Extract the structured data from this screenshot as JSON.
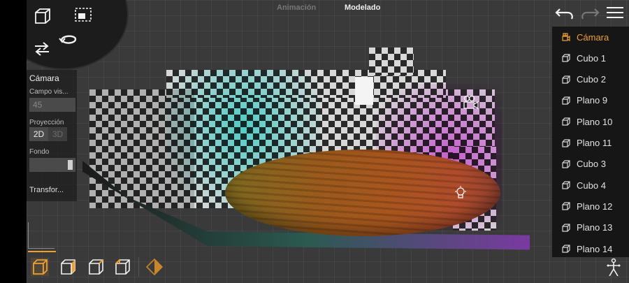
{
  "tabs": [
    {
      "label": "Animación",
      "active": false
    },
    {
      "label": "Modelado",
      "active": true
    }
  ],
  "properties": {
    "title": "Cámara",
    "fov_label": "Campo vis...",
    "fov_value": "45",
    "projection_label": "Proyección",
    "projection_2d": "2D",
    "projection_3d": "3D",
    "background_label": "Fondo",
    "transform_label": "Transfor..."
  },
  "outliner": {
    "items": [
      {
        "label": "Cámara",
        "type": "camera",
        "selected": true
      },
      {
        "label": "Cubo 1",
        "type": "mesh",
        "selected": false
      },
      {
        "label": "Cubo 2",
        "type": "mesh",
        "selected": false
      },
      {
        "label": "Plano 9",
        "type": "mesh",
        "selected": false
      },
      {
        "label": "Plano 10",
        "type": "mesh",
        "selected": false
      },
      {
        "label": "Plano 11",
        "type": "mesh",
        "selected": false
      },
      {
        "label": "Cubo 3",
        "type": "mesh",
        "selected": false
      },
      {
        "label": "Cubo 4",
        "type": "mesh",
        "selected": false
      },
      {
        "label": "Plano 12",
        "type": "mesh",
        "selected": false
      },
      {
        "label": "Plano 13",
        "type": "mesh",
        "selected": false
      },
      {
        "label": "Plano 14",
        "type": "mesh",
        "selected": false
      }
    ]
  },
  "colors": {
    "accent": "#f0a030",
    "panel_bg": "#161616",
    "viewport_bg": "#3a3a3a"
  },
  "icons": {
    "top_left": [
      "cube-view-icon",
      "frame-select-icon",
      "swap-arrows-icon",
      "rotate-icon"
    ],
    "top_right": [
      "undo-icon",
      "redo-icon",
      "menu-icon"
    ],
    "bottom": [
      "select-object-icon",
      "select-face-icon",
      "select-edge-icon",
      "select-vertex-icon",
      "keyframe-diamond-icon",
      "rig-bone-icon"
    ],
    "scene": [
      "camera-gizmo-icon",
      "light-bulb-icon"
    ]
  }
}
